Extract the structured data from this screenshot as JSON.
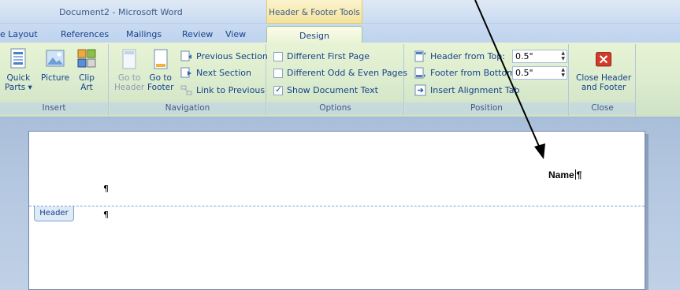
{
  "window": {
    "title": "Document2 - Microsoft Word"
  },
  "contextual": {
    "label": "Header & Footer Tools"
  },
  "tabs": {
    "page_layout": "e Layout",
    "references": "References",
    "mailings": "Mailings",
    "review": "Review",
    "view": "View",
    "design": "Design"
  },
  "groups": {
    "insert": {
      "label": "Insert",
      "quick_parts": [
        "Quick",
        "Parts ▾"
      ],
      "picture": [
        "Picture"
      ],
      "clip_art": [
        "Clip",
        "Art"
      ]
    },
    "navigation": {
      "label": "Navigation",
      "go_to_header": [
        "Go to",
        "Header"
      ],
      "go_to_footer": [
        "Go to",
        "Footer"
      ],
      "previous_section": "Previous Section",
      "next_section": "Next Section",
      "link_to_previous": "Link to Previous"
    },
    "options": {
      "label": "Options",
      "different_first_page": "Different First Page",
      "different_odd_even": "Different Odd & Even Pages",
      "show_document_text": "Show Document Text",
      "checked": {
        "different_first_page": false,
        "different_odd_even": false,
        "show_document_text": true
      }
    },
    "position": {
      "label": "Position",
      "header_from_top_label": "Header from Top:",
      "header_from_top_value": "0.5\"",
      "footer_from_bottom_label": "Footer from Bottom:",
      "footer_from_bottom_value": "0.5\"",
      "insert_alignment_tab": "Insert Alignment Tab"
    },
    "close": {
      "label": "Close",
      "close_header_footer": [
        "Close Header",
        "and Footer"
      ]
    }
  },
  "document": {
    "header_tag": "Header",
    "name_text": "Name",
    "pilcrow": "¶"
  },
  "colors": {
    "ribbon_text": "#15428b",
    "contextual": "#f4e39a",
    "close_red": "#d23a2a",
    "header_dashed": "#7aa5d6"
  }
}
